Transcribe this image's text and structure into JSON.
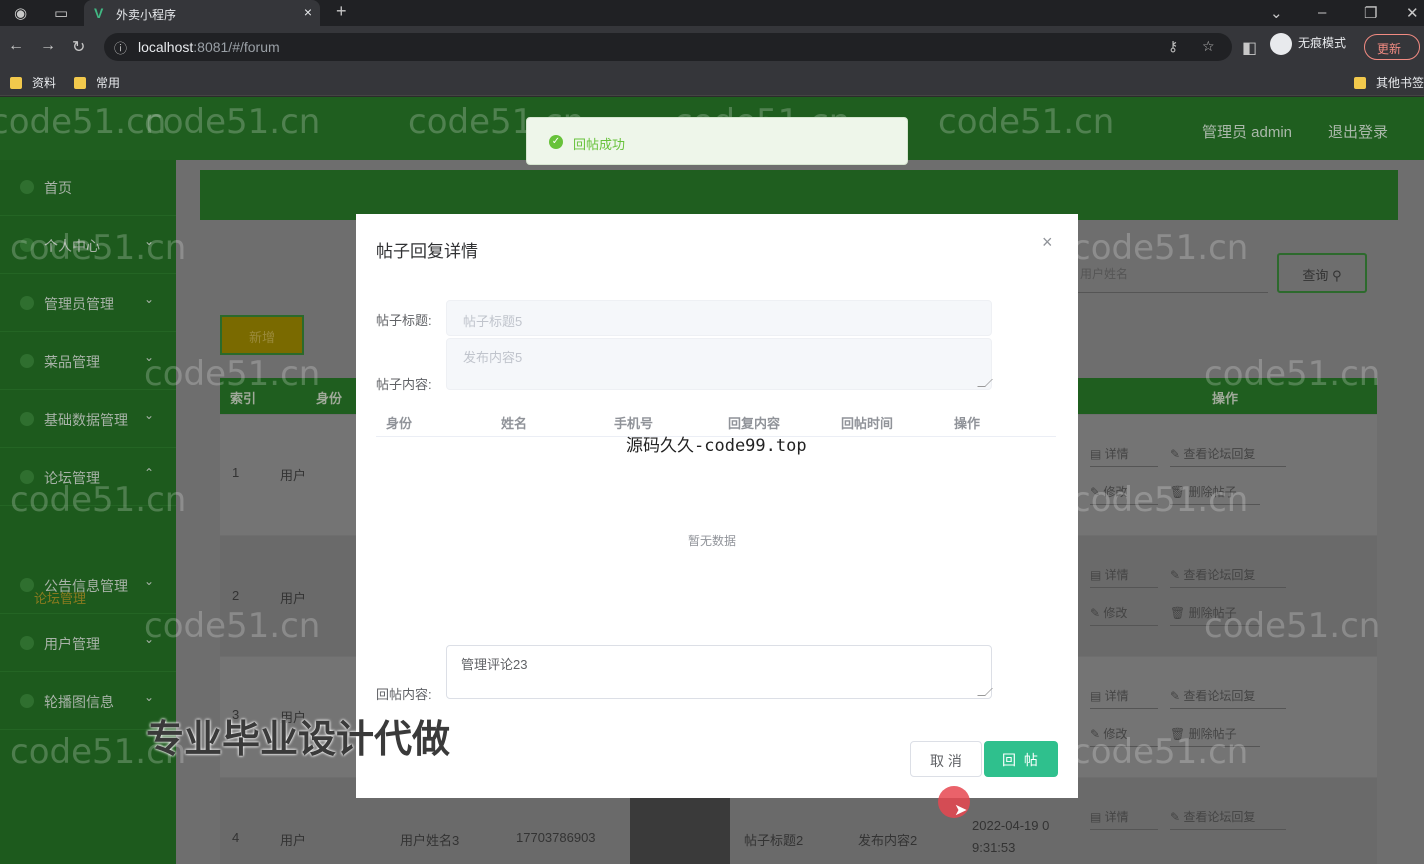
{
  "browser": {
    "tab_title": "外卖小程序",
    "tab_close": "×",
    "new_tab": "+",
    "url_host": "localhost",
    "url_rest": ":8081/#/forum",
    "incognito_label": "无痕模式",
    "update_label": "更新",
    "bookmarks": [
      "资料",
      "常用"
    ],
    "other_bookmarks": "其他书签"
  },
  "header": {
    "user_label": "管理员 admin",
    "logout_label": "退出登录"
  },
  "sidebar": {
    "items": [
      "首页",
      "个人中心",
      "管理员管理",
      "菜品管理",
      "基础数据管理",
      "论坛管理",
      "公告信息管理",
      "用户管理",
      "轮播图信息"
    ],
    "active_sub": "论坛管理"
  },
  "toolbar": {
    "add_label": "新增",
    "search_placeholder": "用户姓名",
    "query_label": "查询"
  },
  "table": {
    "headers": [
      "索引",
      "身份",
      "操作"
    ],
    "rows": [
      {
        "index": "1",
        "role": "用户"
      },
      {
        "index": "2",
        "role": "用户"
      },
      {
        "index": "3",
        "role": "用户"
      },
      {
        "index": "4",
        "role": "用户",
        "name": "用户姓名3",
        "phone": "17703786903",
        "title": "帖子标题2",
        "content": "发布内容2",
        "time": "2022-04-19 0",
        "time2": "9:31:53"
      }
    ],
    "actions": [
      "详情",
      "查看论坛回复",
      "修改",
      "删除帖子"
    ]
  },
  "toast": {
    "message": "回帖成功"
  },
  "dialog": {
    "title": "帖子回复详情",
    "close": "×",
    "post_title_label": "帖子标题:",
    "post_title_value": "帖子标题5",
    "post_content_label": "帖子内容:",
    "post_content_value": "发布内容5",
    "columns": [
      "身份",
      "姓名",
      "手机号",
      "回复内容",
      "回帖时间",
      "操作"
    ],
    "empty_text": "暂无数据",
    "reply_label": "回帖内容:",
    "reply_value": "管理评论23",
    "cancel_label": "取 消",
    "reply_button_label": "回 帖"
  },
  "overlay": {
    "site_watermark": "源码久久-code99.top",
    "promo": "专业毕业设计代做",
    "watermark": "code51.cn"
  }
}
